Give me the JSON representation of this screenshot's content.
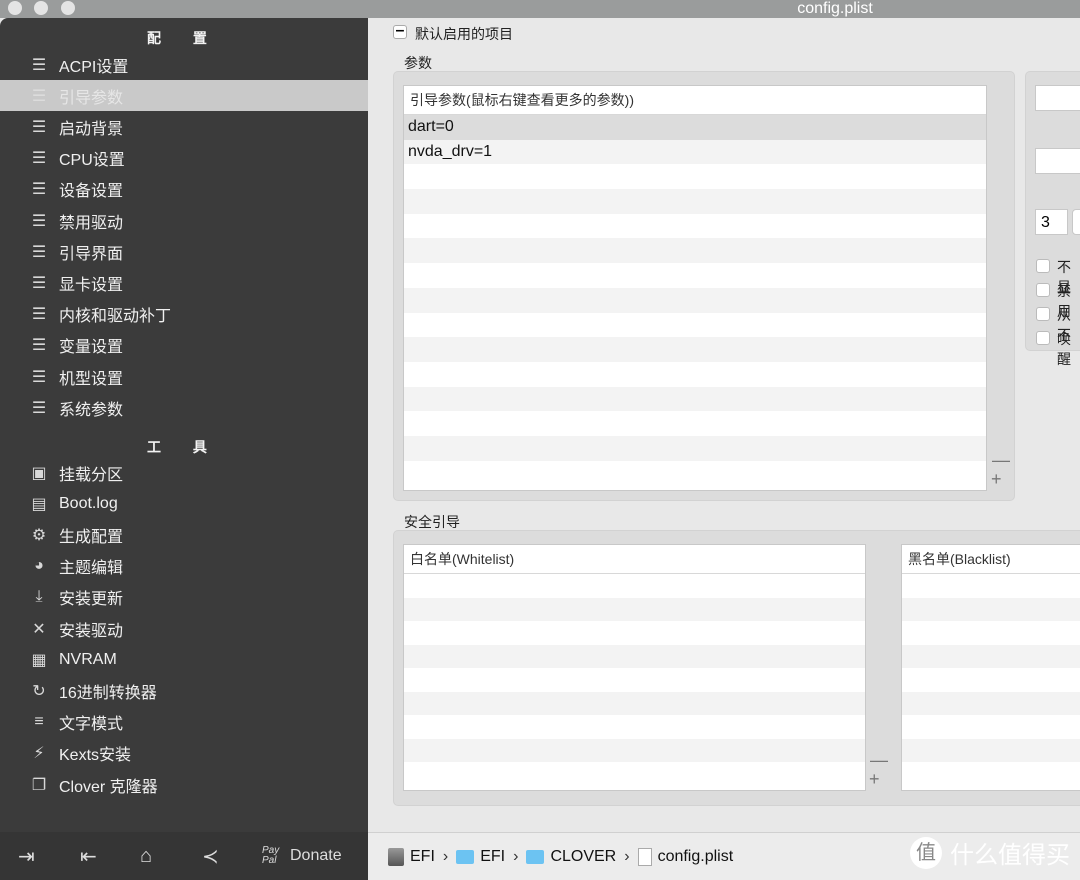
{
  "window": {
    "title": "config.plist"
  },
  "sidebar": {
    "section_config": "配 置",
    "config_items": [
      {
        "label": "ACPI设置",
        "icon": "list-icon"
      },
      {
        "label": "引导参数",
        "icon": "list-icon",
        "selected": true
      },
      {
        "label": "启动背景",
        "icon": "list-icon"
      },
      {
        "label": "CPU设置",
        "icon": "list-icon"
      },
      {
        "label": "设备设置",
        "icon": "list-icon"
      },
      {
        "label": "禁用驱动",
        "icon": "list-icon"
      },
      {
        "label": "引导界面",
        "icon": "list-icon"
      },
      {
        "label": "显卡设置",
        "icon": "list-icon"
      },
      {
        "label": "内核和驱动补丁",
        "icon": "list-icon"
      },
      {
        "label": "变量设置",
        "icon": "list-icon"
      },
      {
        "label": "机型设置",
        "icon": "list-icon"
      },
      {
        "label": "系统参数",
        "icon": "list-icon"
      }
    ],
    "section_tools": "工 具",
    "tool_items": [
      {
        "label": "挂载分区",
        "icon": "disk-icon"
      },
      {
        "label": "Boot.log",
        "icon": "log-icon"
      },
      {
        "label": "生成配置",
        "icon": "gears-icon"
      },
      {
        "label": "主题编辑",
        "icon": "palette-icon"
      },
      {
        "label": "安装更新",
        "icon": "download-icon"
      },
      {
        "label": "安装驱动",
        "icon": "tools-icon"
      },
      {
        "label": "NVRAM",
        "icon": "chip-icon"
      },
      {
        "label": "16进制转换器",
        "icon": "refresh-icon"
      },
      {
        "label": "文字模式",
        "icon": "text-icon"
      },
      {
        "label": "Kexts安装",
        "icon": "plug-icon"
      },
      {
        "label": "Clover 克隆器",
        "icon": "clone-icon"
      }
    ],
    "bottom": {
      "donate_label": "Donate",
      "paypal": "Pay Pal"
    }
  },
  "main": {
    "default_toggle_label": "默认启用的项目",
    "args_section": "参数",
    "args_table": {
      "header": "引导参数(鼠标右键查看更多的参数))",
      "rows": [
        "dart=0",
        "nvda_drv=1"
      ]
    },
    "side_number": "3",
    "side_checkboxes": [
      "不显",
      "禁用",
      "从不",
      "唤醒"
    ],
    "secure_section": "安全引导",
    "whitelist_header": "白名单(Whitelist)",
    "blacklist_header": "黑名单(Blacklist)"
  },
  "footer": {
    "path": [
      "EFI",
      "EFI",
      "CLOVER",
      "config.plist"
    ]
  },
  "watermark": {
    "text": "什么值得买",
    "glyph": "值"
  }
}
